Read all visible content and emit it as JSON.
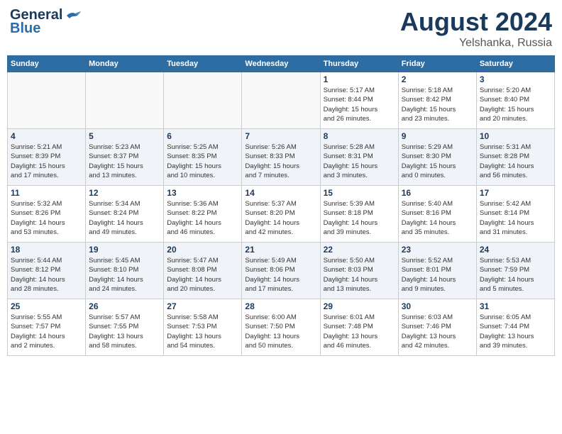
{
  "header": {
    "logo_line1": "General",
    "logo_line2": "Blue",
    "month": "August 2024",
    "location": "Yelshanka, Russia"
  },
  "days_of_week": [
    "Sunday",
    "Monday",
    "Tuesday",
    "Wednesday",
    "Thursday",
    "Friday",
    "Saturday"
  ],
  "weeks": [
    [
      {
        "day": "",
        "info": ""
      },
      {
        "day": "",
        "info": ""
      },
      {
        "day": "",
        "info": ""
      },
      {
        "day": "",
        "info": ""
      },
      {
        "day": "1",
        "info": "Sunrise: 5:17 AM\nSunset: 8:44 PM\nDaylight: 15 hours\nand 26 minutes."
      },
      {
        "day": "2",
        "info": "Sunrise: 5:18 AM\nSunset: 8:42 PM\nDaylight: 15 hours\nand 23 minutes."
      },
      {
        "day": "3",
        "info": "Sunrise: 5:20 AM\nSunset: 8:40 PM\nDaylight: 15 hours\nand 20 minutes."
      }
    ],
    [
      {
        "day": "4",
        "info": "Sunrise: 5:21 AM\nSunset: 8:39 PM\nDaylight: 15 hours\nand 17 minutes."
      },
      {
        "day": "5",
        "info": "Sunrise: 5:23 AM\nSunset: 8:37 PM\nDaylight: 15 hours\nand 13 minutes."
      },
      {
        "day": "6",
        "info": "Sunrise: 5:25 AM\nSunset: 8:35 PM\nDaylight: 15 hours\nand 10 minutes."
      },
      {
        "day": "7",
        "info": "Sunrise: 5:26 AM\nSunset: 8:33 PM\nDaylight: 15 hours\nand 7 minutes."
      },
      {
        "day": "8",
        "info": "Sunrise: 5:28 AM\nSunset: 8:31 PM\nDaylight: 15 hours\nand 3 minutes."
      },
      {
        "day": "9",
        "info": "Sunrise: 5:29 AM\nSunset: 8:30 PM\nDaylight: 15 hours\nand 0 minutes."
      },
      {
        "day": "10",
        "info": "Sunrise: 5:31 AM\nSunset: 8:28 PM\nDaylight: 14 hours\nand 56 minutes."
      }
    ],
    [
      {
        "day": "11",
        "info": "Sunrise: 5:32 AM\nSunset: 8:26 PM\nDaylight: 14 hours\nand 53 minutes."
      },
      {
        "day": "12",
        "info": "Sunrise: 5:34 AM\nSunset: 8:24 PM\nDaylight: 14 hours\nand 49 minutes."
      },
      {
        "day": "13",
        "info": "Sunrise: 5:36 AM\nSunset: 8:22 PM\nDaylight: 14 hours\nand 46 minutes."
      },
      {
        "day": "14",
        "info": "Sunrise: 5:37 AM\nSunset: 8:20 PM\nDaylight: 14 hours\nand 42 minutes."
      },
      {
        "day": "15",
        "info": "Sunrise: 5:39 AM\nSunset: 8:18 PM\nDaylight: 14 hours\nand 39 minutes."
      },
      {
        "day": "16",
        "info": "Sunrise: 5:40 AM\nSunset: 8:16 PM\nDaylight: 14 hours\nand 35 minutes."
      },
      {
        "day": "17",
        "info": "Sunrise: 5:42 AM\nSunset: 8:14 PM\nDaylight: 14 hours\nand 31 minutes."
      }
    ],
    [
      {
        "day": "18",
        "info": "Sunrise: 5:44 AM\nSunset: 8:12 PM\nDaylight: 14 hours\nand 28 minutes."
      },
      {
        "day": "19",
        "info": "Sunrise: 5:45 AM\nSunset: 8:10 PM\nDaylight: 14 hours\nand 24 minutes."
      },
      {
        "day": "20",
        "info": "Sunrise: 5:47 AM\nSunset: 8:08 PM\nDaylight: 14 hours\nand 20 minutes."
      },
      {
        "day": "21",
        "info": "Sunrise: 5:49 AM\nSunset: 8:06 PM\nDaylight: 14 hours\nand 17 minutes."
      },
      {
        "day": "22",
        "info": "Sunrise: 5:50 AM\nSunset: 8:03 PM\nDaylight: 14 hours\nand 13 minutes."
      },
      {
        "day": "23",
        "info": "Sunrise: 5:52 AM\nSunset: 8:01 PM\nDaylight: 14 hours\nand 9 minutes."
      },
      {
        "day": "24",
        "info": "Sunrise: 5:53 AM\nSunset: 7:59 PM\nDaylight: 14 hours\nand 5 minutes."
      }
    ],
    [
      {
        "day": "25",
        "info": "Sunrise: 5:55 AM\nSunset: 7:57 PM\nDaylight: 14 hours\nand 2 minutes."
      },
      {
        "day": "26",
        "info": "Sunrise: 5:57 AM\nSunset: 7:55 PM\nDaylight: 13 hours\nand 58 minutes."
      },
      {
        "day": "27",
        "info": "Sunrise: 5:58 AM\nSunset: 7:53 PM\nDaylight: 13 hours\nand 54 minutes."
      },
      {
        "day": "28",
        "info": "Sunrise: 6:00 AM\nSunset: 7:50 PM\nDaylight: 13 hours\nand 50 minutes."
      },
      {
        "day": "29",
        "info": "Sunrise: 6:01 AM\nSunset: 7:48 PM\nDaylight: 13 hours\nand 46 minutes."
      },
      {
        "day": "30",
        "info": "Sunrise: 6:03 AM\nSunset: 7:46 PM\nDaylight: 13 hours\nand 42 minutes."
      },
      {
        "day": "31",
        "info": "Sunrise: 6:05 AM\nSunset: 7:44 PM\nDaylight: 13 hours\nand 39 minutes."
      }
    ]
  ]
}
